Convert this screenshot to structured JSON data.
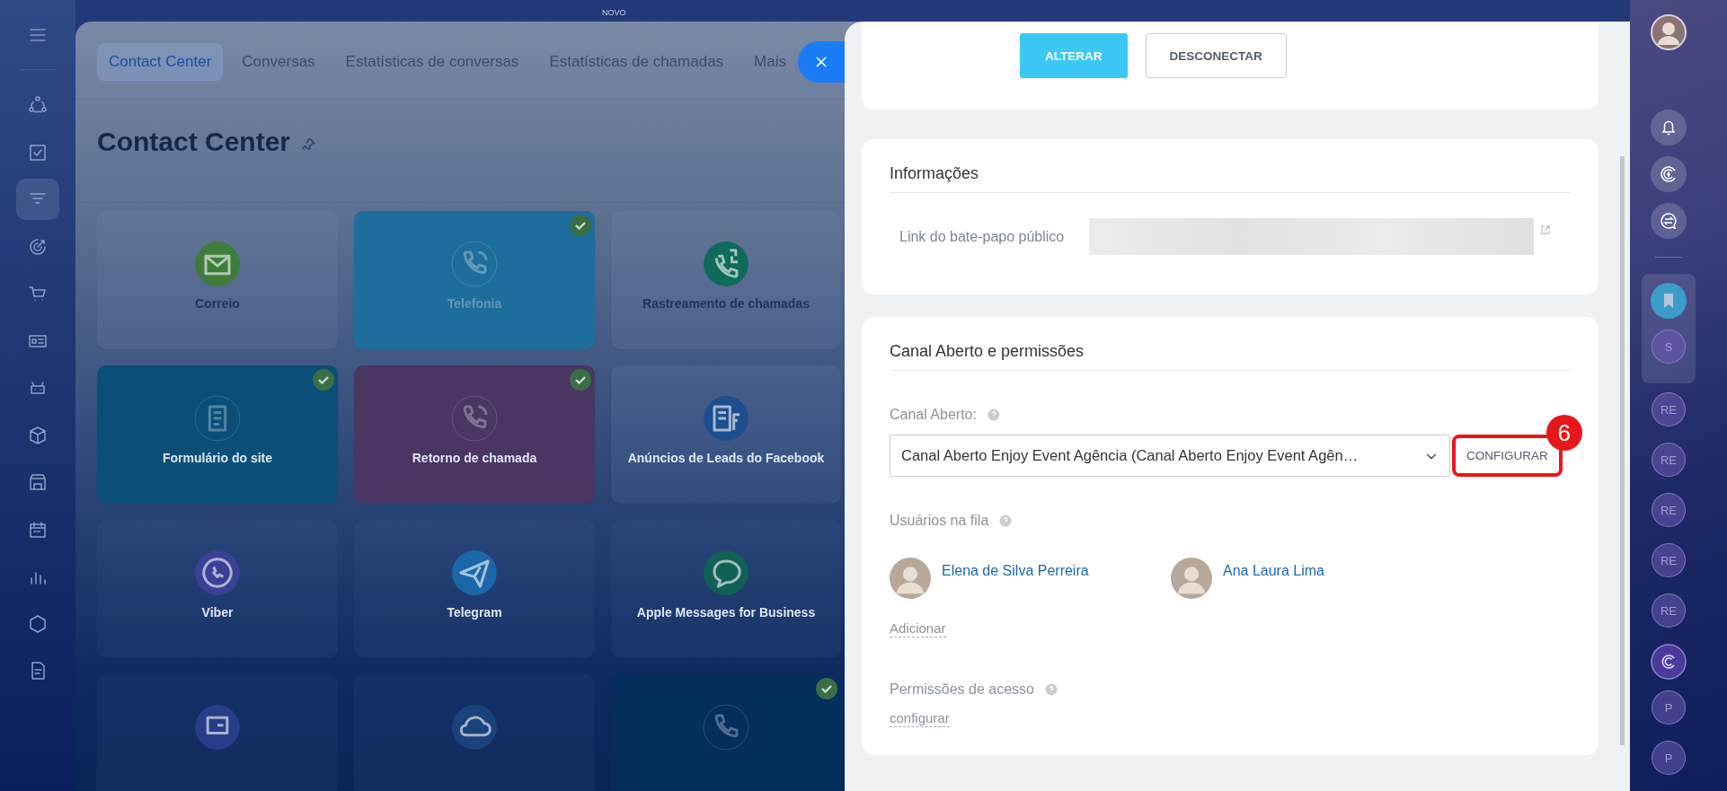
{
  "left_rail": {
    "items": [
      {
        "selected": false
      },
      {
        "selected": false
      },
      {
        "selected": true
      },
      {
        "selected": false
      },
      {
        "selected": false
      },
      {
        "selected": false
      },
      {
        "selected": false
      },
      {
        "selected": false
      },
      {
        "selected": false
      },
      {
        "selected": false
      },
      {
        "selected": false
      },
      {
        "selected": false
      },
      {
        "selected": false
      }
    ]
  },
  "top_badge": "NOVO",
  "tabs": [
    {
      "label": "Contact Center",
      "selected": true
    },
    {
      "label": "Conversas",
      "selected": false
    },
    {
      "label": "Estatísticas de conversas",
      "selected": false
    },
    {
      "label": "Estatísticas de chamadas",
      "selected": false
    },
    {
      "label": "Mais",
      "selected": false
    }
  ],
  "page_title": "Contact Center",
  "connectors": [
    {
      "label": "Correio",
      "connected": false
    },
    {
      "label": "Telefonia",
      "connected": true,
      "color": "#1d6e9c"
    },
    {
      "label": "Rastreamento de chamadas",
      "connected": false
    },
    {
      "label": "Formulário do site",
      "connected": true,
      "color": "#0b4f78"
    },
    {
      "label": "Retorno de chamada",
      "connected": true,
      "color": "#4a3563"
    },
    {
      "label": "Anúncios de Leads do Facebook",
      "connected": false
    },
    {
      "label": "Viber",
      "connected": false
    },
    {
      "label": "Telegram",
      "connected": false
    },
    {
      "label": "Apple Messages for Business",
      "connected": false
    },
    {
      "connected": false
    },
    {
      "connected": false
    },
    {
      "connected": true,
      "color": "#042e5c"
    }
  ],
  "panel": {
    "buttons": [
      {
        "label": "ALTERAR",
        "kind": "primary"
      },
      {
        "label": "DESCONECTAR",
        "kind": "secondary"
      }
    ],
    "info": {
      "title": "Informações",
      "link_label": "Link do bate-papo público"
    },
    "permissions": {
      "title": "Canal Aberto e permissões",
      "channel_label": "Canal Aberto:",
      "channel_value": "Canal Aberto Enjoy Event Agência (Canal Aberto Enjoy Event Agên…",
      "configure_button": {
        "label": "CONFIGURAR",
        "highlighted": true,
        "callout": "6"
      },
      "queue_label": "Usuários na fila",
      "users": [
        {
          "name": "Elena de Silva Perreira"
        },
        {
          "name": "Ana Laura Lima"
        }
      ],
      "add_link": "Adicionar",
      "access_label": "Permissões de acesso",
      "access_link": "configurar"
    }
  },
  "right_rail": {
    "pinned": [
      {
        "kind": "bookmark"
      },
      {
        "kind": "initials",
        "text": "S"
      }
    ],
    "chats": [
      {
        "kind": "initials",
        "text": "RE"
      },
      {
        "kind": "initials",
        "text": "RE"
      },
      {
        "kind": "initials",
        "text": "RE"
      },
      {
        "kind": "initials",
        "text": "RE"
      },
      {
        "kind": "initials",
        "text": "RE"
      },
      {
        "kind": "logo"
      },
      {
        "kind": "initials",
        "text": "P"
      },
      {
        "kind": "initials",
        "text": "P"
      }
    ]
  }
}
